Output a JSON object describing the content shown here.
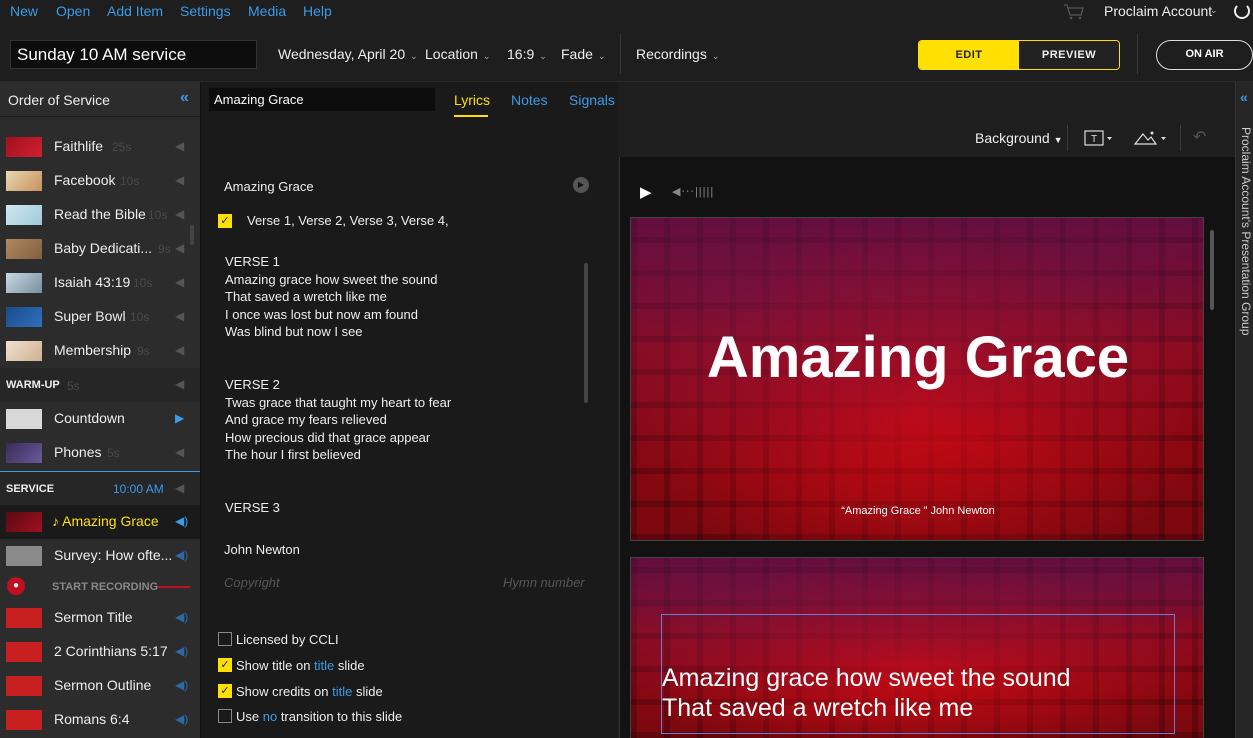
{
  "menu": {
    "items": [
      "New",
      "Open",
      "Add Item",
      "Settings",
      "Media",
      "Help"
    ],
    "account": "Proclaim Account"
  },
  "toolbar": {
    "service_name": "Sunday 10 AM service",
    "date": "Wednesday, April 20",
    "location": "Location",
    "aspect": "16:9",
    "transition": "Fade",
    "recordings": "Recordings",
    "edit": "EDIT",
    "preview": "PREVIEW",
    "on_air": "ON AIR"
  },
  "sidebar": {
    "title": "Order of Service",
    "pre_items": [
      {
        "name": "Faithlife",
        "duration": "25s"
      },
      {
        "name": "Facebook",
        "duration": "10s"
      },
      {
        "name": "Read the Bible",
        "duration": "10s"
      },
      {
        "name": "Baby Dedicati...",
        "duration": "9s"
      },
      {
        "name": "Isaiah 43:19",
        "duration": "10s"
      },
      {
        "name": "Super Bowl",
        "duration": "10s"
      },
      {
        "name": "Membership",
        "duration": "9s"
      }
    ],
    "warmup": {
      "label": "WARM-UP",
      "duration": "5s"
    },
    "warmup_items": [
      {
        "name": "Countdown"
      },
      {
        "name": "Phones",
        "duration": "5s"
      }
    ],
    "service": {
      "label": "SERVICE",
      "time": "10:00 AM"
    },
    "service_items": [
      {
        "name": "Amazing Grace"
      },
      {
        "name": "Survey: How ofte..."
      },
      {
        "name": "START RECORDING"
      },
      {
        "name": "Sermon Title"
      },
      {
        "name": "2 Corinthians 5:17"
      },
      {
        "name": "Sermon Outline"
      },
      {
        "name": "Romans 6:4"
      }
    ]
  },
  "editor": {
    "title_field": "Amazing Grace",
    "tabs": [
      "Lyrics",
      "Notes",
      "Signals"
    ],
    "song_title": "Amazing Grace",
    "order": "Verse 1, Verse 2, Verse 3, Verse 4,",
    "verse1": {
      "head": "VERSE 1",
      "lines": [
        "Amazing grace how sweet the sound",
        "That saved a wretch like me",
        "I once was lost but now am found",
        "Was blind but now I see"
      ]
    },
    "verse2": {
      "head": "VERSE 2",
      "lines": [
        "Twas grace that taught my heart to fear",
        "And grace my fears relieved",
        "How precious did that grace appear",
        "The hour I first believed"
      ]
    },
    "verse3_head": "VERSE 3",
    "author": "John Newton",
    "copyright_placeholder": "Copyright",
    "hymn_number_placeholder": "Hymn number",
    "options": {
      "ccli": "Licensed by CCLI",
      "title_pre": "Show title on ",
      "title_hl": "title",
      "title_post": " slide",
      "credits_pre": "Show credits on ",
      "credits_hl": "title",
      "credits_post": " slide",
      "trans_pre": "Use ",
      "trans_hl": "no",
      "trans_post": " transition to this slide"
    }
  },
  "preview": {
    "background_menu": "Background",
    "slide1_title": "Amazing Grace",
    "slide1_credit": "“Amazing Grace ” John Newton",
    "slide2_lines": [
      "Amazing grace how sweet the sound",
      "That saved a wretch like me"
    ]
  },
  "right_panel": {
    "label": "Proclaim Account's Presentation Group"
  },
  "colors": {
    "accent_yellow": "#ffe000",
    "link_blue": "#3a9be8",
    "slide_red": "#9a0812"
  }
}
